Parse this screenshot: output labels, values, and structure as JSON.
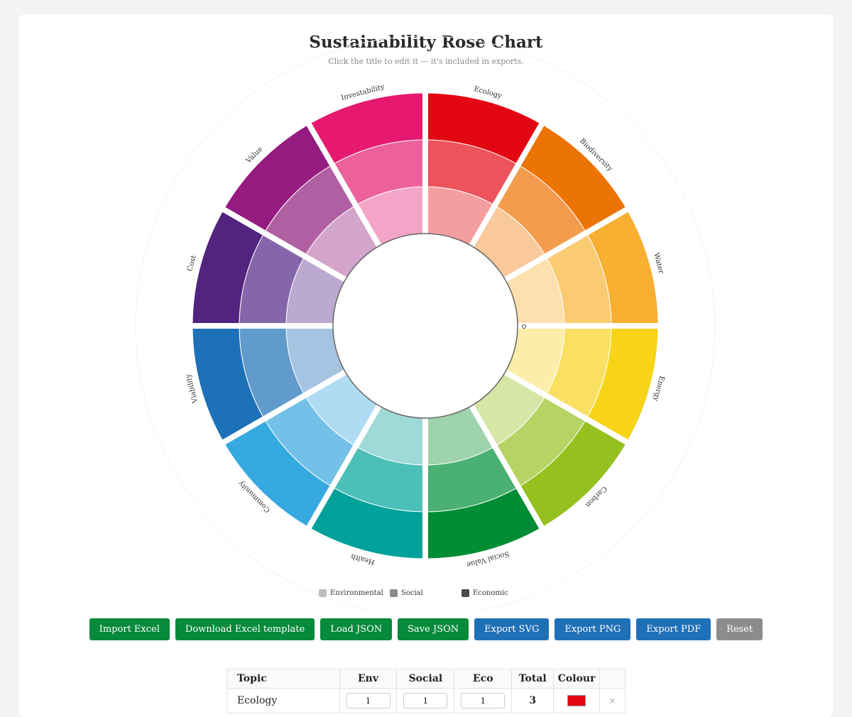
{
  "page": {
    "title": "Sustainability Rose Chart",
    "subtitle": "Click the title to edit it — it's included in exports."
  },
  "chart_data": {
    "type": "rose",
    "title": "Sustainability Rose Chart",
    "rings": [
      "Environmental",
      "Social",
      "Economic"
    ],
    "legend": [
      {
        "label": "Environmental",
        "color": "#bdbdbd"
      },
      {
        "label": "Social",
        "color": "#8a8a8a"
      },
      {
        "label": "Economic",
        "color": "#4a4a4a"
      }
    ],
    "topics": [
      {
        "name": "Ecology",
        "env": 1,
        "social": 1,
        "eco": 1,
        "colors": [
          "#f59ea0",
          "#ec535a",
          "#e30613"
        ]
      },
      {
        "name": "Biodiversity",
        "env": 1,
        "social": 1,
        "eco": 1,
        "colors": [
          "#f9c89b",
          "#f39c4d",
          "#ec7404"
        ]
      },
      {
        "name": "Water",
        "env": 1,
        "social": 1,
        "eco": 1,
        "colors": [
          "#fde0ad",
          "#fbcb72",
          "#f8af32"
        ]
      },
      {
        "name": "Energy",
        "env": 1,
        "social": 1,
        "eco": 1,
        "colors": [
          "#fcedaa",
          "#f9e063",
          "#f7d418"
        ]
      },
      {
        "name": "Carbon",
        "env": 1,
        "social": 1,
        "eco": 1,
        "colors": [
          "#d7e6a6",
          "#b5d463",
          "#95c11f"
        ]
      },
      {
        "name": "Social Value",
        "env": 1,
        "social": 1,
        "eco": 1,
        "colors": [
          "#9ed3ac",
          "#4ab073",
          "#008d36"
        ]
      },
      {
        "name": "Health",
        "env": 1,
        "social": 1,
        "eco": 1,
        "colors": [
          "#9fdad8",
          "#4dbfb9",
          "#00a19a"
        ]
      },
      {
        "name": "Community",
        "env": 1,
        "social": 1,
        "eco": 1,
        "colors": [
          "#b0dcf3",
          "#73c1e8",
          "#36a9e1"
        ]
      },
      {
        "name": "Viability",
        "env": 1,
        "social": 1,
        "eco": 1,
        "colors": [
          "#a5c4e1",
          "#609bcc",
          "#1d71b8"
        ]
      },
      {
        "name": "Cost",
        "env": 1,
        "social": 1,
        "eco": 1,
        "colors": [
          "#bba9cf",
          "#8666aa",
          "#52237f"
        ]
      },
      {
        "name": "Value",
        "env": 1,
        "social": 1,
        "eco": 1,
        "colors": [
          "#d4a5cb",
          "#b15fa3",
          "#951b81"
        ]
      },
      {
        "name": "Investability",
        "env": 1,
        "social": 1,
        "eco": 1,
        "colors": [
          "#f4a5c7",
          "#ec609b",
          "#e6186f"
        ]
      }
    ]
  },
  "toolbar": {
    "import_excel": "Import Excel",
    "download_template": "Download Excel template",
    "load_json": "Load JSON",
    "save_json": "Save JSON",
    "export_svg": "Export SVG",
    "export_png": "Export PNG",
    "export_pdf": "Export PDF",
    "reset": "Reset"
  },
  "table": {
    "headers": {
      "topic": "Topic",
      "env": "Env",
      "social": "Social",
      "eco": "Eco",
      "total": "Total",
      "colour": "Colour"
    },
    "rows": [
      {
        "topic": "Ecology",
        "env": "1",
        "social": "1",
        "eco": "1",
        "total": "3",
        "colour": "#e30613",
        "remove": "×"
      }
    ]
  }
}
